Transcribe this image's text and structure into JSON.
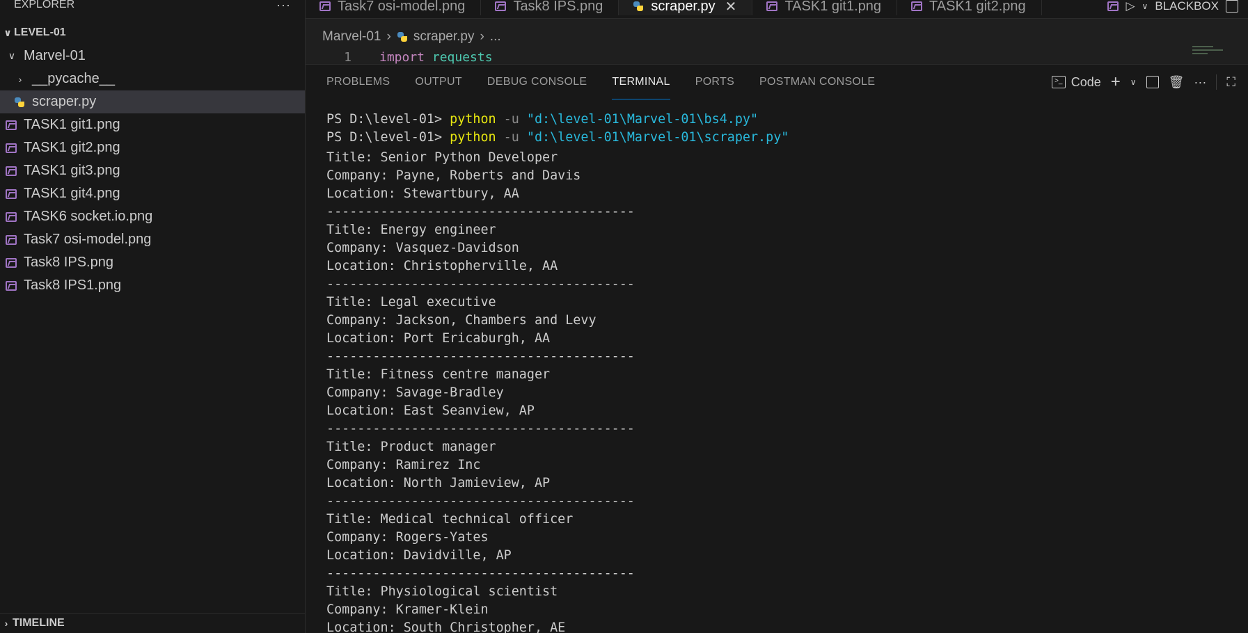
{
  "sidebar": {
    "header": "EXPLORER",
    "more": "···",
    "root": "LEVEL-01",
    "folder": "Marvel-01",
    "pycache": "__pycache__",
    "active_file": "scraper.py",
    "files": [
      "TASK1 git1.png",
      "TASK1 git2.png",
      "TASK1 git3.png",
      "TASK1 git4.png",
      "TASK6 socket.io.png",
      "Task7 osi-model.png",
      "Task8 IPS.png",
      "Task8 IPS1.png"
    ],
    "timeline": "TIMELINE"
  },
  "tabs": [
    {
      "label": "Task7 osi-model.png",
      "type": "image"
    },
    {
      "label": "Task8 IPS.png",
      "type": "image"
    },
    {
      "label": "scraper.py",
      "type": "python",
      "active": true
    },
    {
      "label": "TASK1 git1.png",
      "type": "image"
    },
    {
      "label": "TASK1 git2.png",
      "type": "image"
    }
  ],
  "tab_actions": {
    "extension": "BLACKBOX"
  },
  "breadcrumb": {
    "folder": "Marvel-01",
    "file": "scraper.py",
    "more": "..."
  },
  "editor": {
    "line_number": "1",
    "keyword": "import",
    "module": "requests"
  },
  "panel": {
    "tabs": [
      "PROBLEMS",
      "OUTPUT",
      "DEBUG CONSOLE",
      "TERMINAL",
      "PORTS",
      "POSTMAN CONSOLE"
    ],
    "active_tab": "TERMINAL",
    "shell_label": "Code"
  },
  "terminal": {
    "commands": [
      {
        "prompt": "PS D:\\level-01> ",
        "cmd": "python",
        "flag": " -u ",
        "arg": "\"d:\\level-01\\Marvel-01\\bs4.py\""
      },
      {
        "prompt": "PS D:\\level-01> ",
        "cmd": "python",
        "flag": " -u ",
        "arg": "\"d:\\level-01\\Marvel-01\\scraper.py\""
      }
    ],
    "separator": "----------------------------------------",
    "jobs": [
      {
        "title": "Title: Senior Python Developer",
        "company": "Company: Payne, Roberts and Davis",
        "location": "Location: Stewartbury, AA"
      },
      {
        "title": "Title: Energy engineer",
        "company": "Company: Vasquez-Davidson",
        "location": "Location: Christopherville, AA"
      },
      {
        "title": "Title: Legal executive",
        "company": "Company: Jackson, Chambers and Levy",
        "location": "Location: Port Ericaburgh, AA"
      },
      {
        "title": "Title: Fitness centre manager",
        "company": "Company: Savage-Bradley",
        "location": "Location: East Seanview, AP"
      },
      {
        "title": "Title: Product manager",
        "company": "Company: Ramirez Inc",
        "location": "Location: North Jamieview, AP"
      },
      {
        "title": "Title: Medical technical officer",
        "company": "Company: Rogers-Yates",
        "location": "Location: Davidville, AP"
      },
      {
        "title": "Title: Physiological scientist",
        "company": "Company: Kramer-Klein",
        "location": "Location: South Christopher, AE"
      }
    ]
  },
  "colors": {
    "accent": "#0078d4",
    "python_cmd": "#e5e510",
    "string": "#29b8db",
    "keyword": "#c586c0",
    "module": "#4ec9b0"
  }
}
